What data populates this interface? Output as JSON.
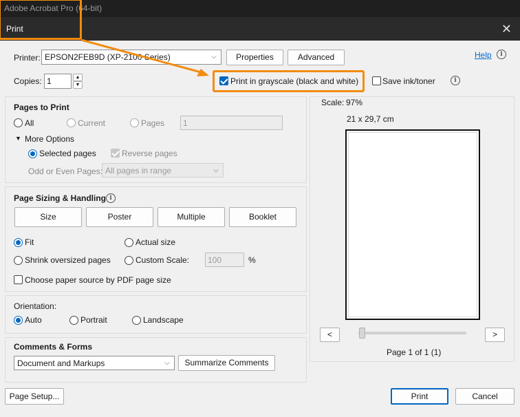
{
  "app": {
    "title": "Adobe Acrobat Pro (64-bit)"
  },
  "dialog": {
    "title": "Print",
    "close_glyph": "✕"
  },
  "top": {
    "printer_label": "Printer:",
    "printer_value": "EPSON2FEB9D (XP-2100 Series)",
    "properties_label": "Properties",
    "advanced_label": "Advanced",
    "help_label": "Help",
    "copies_label": "Copies:",
    "copies_value": "1",
    "grayscale_label": "Print in grayscale (black and white)",
    "grayscale_checked": true,
    "save_ink_label": "Save ink/toner",
    "save_ink_checked": false
  },
  "pages_to_print": {
    "title": "Pages to Print",
    "all_label": "All",
    "current_label": "Current",
    "pages_label": "Pages",
    "pages_value": "1",
    "more_options_label": "More Options",
    "selected_pages_label": "Selected pages",
    "reverse_pages_label": "Reverse pages",
    "odd_even_label": "Odd or Even Pages:",
    "odd_even_value": "All pages in range"
  },
  "page_sizing": {
    "title": "Page Sizing & Handling",
    "size_label": "Size",
    "poster_label": "Poster",
    "multiple_label": "Multiple",
    "booklet_label": "Booklet",
    "fit_label": "Fit",
    "actual_size_label": "Actual size",
    "shrink_label": "Shrink oversized pages",
    "custom_scale_label": "Custom Scale:",
    "custom_scale_value": "100",
    "percent_label": "%",
    "paper_source_label": "Choose paper source by PDF page size"
  },
  "orientation": {
    "title": "Orientation:",
    "auto_label": "Auto",
    "portrait_label": "Portrait",
    "landscape_label": "Landscape"
  },
  "comments": {
    "title": "Comments & Forms",
    "value": "Document and Markups",
    "summarize_label": "Summarize Comments"
  },
  "preview": {
    "scale_label": "Scale:",
    "scale_value": "97%",
    "dimensions": "21 x 29,7 cm",
    "prev_glyph": "<",
    "next_glyph": ">",
    "page_indicator": "Page 1 of 1 (1)"
  },
  "footer": {
    "page_setup_label": "Page Setup...",
    "print_label": "Print",
    "cancel_label": "Cancel"
  },
  "colors": {
    "accent": "#0067c0",
    "highlight": "#f28c0f",
    "app_titlebar": "#1f1f1f",
    "dialog_titlebar": "#2b2b2b"
  }
}
